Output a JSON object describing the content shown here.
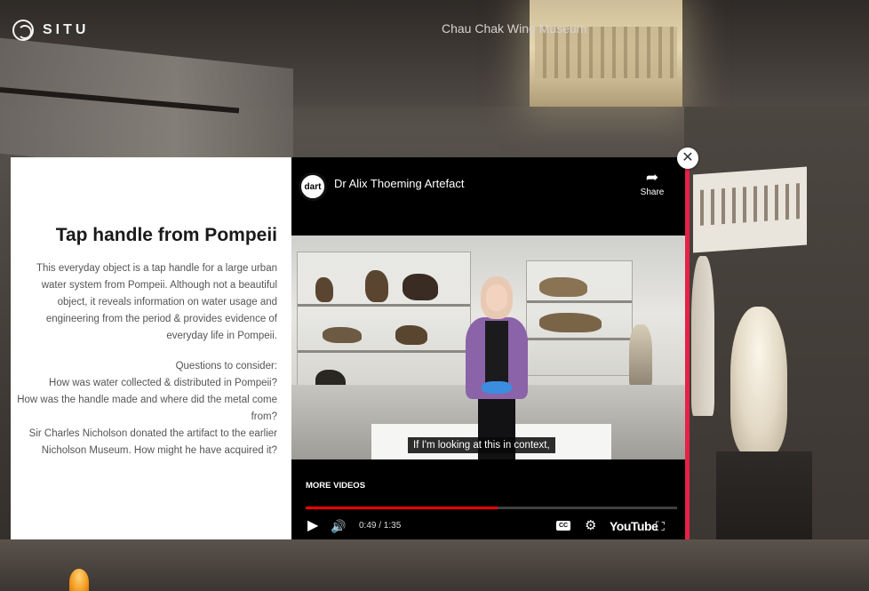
{
  "header": {
    "brand_name": "SITU",
    "brand_icon": "situ-logo-icon",
    "tour_title": "Chau Chak Wing Museum"
  },
  "info_panel": {
    "title": "Tap handle from Pompeii",
    "description": "This everyday object is a tap handle for a large urban water system from Pompeii. Although not a beautiful object, it reveals information on water usage and engineering from the period & provides evidence of everyday life in Pompeii.",
    "questions_heading": "Questions to consider:",
    "questions": [
      "How was water collected & distributed in Pompeii?",
      "How was the handle made and where did the metal come from?",
      "Sir Charles Nicholson donated the artifact to the earlier Nicholson Museum. How might he have acquired it?"
    ]
  },
  "video_player": {
    "channel_logo_text": "dart",
    "video_title": "Dr Alix Thoeming Artefact",
    "share_label": "Share",
    "caption_text": "If I'm looking at this in context,",
    "more_videos_label": "MORE VIDEOS",
    "current_time": "0:49",
    "duration": "1:35",
    "time_display": "0:49 / 1:35",
    "progress_fraction": 0.516,
    "cc_label": "CC",
    "platform_logo": "YouTube",
    "accent_color": "#e62148",
    "progress_color": "#ff0000"
  },
  "close_button": {
    "icon": "close-icon"
  }
}
